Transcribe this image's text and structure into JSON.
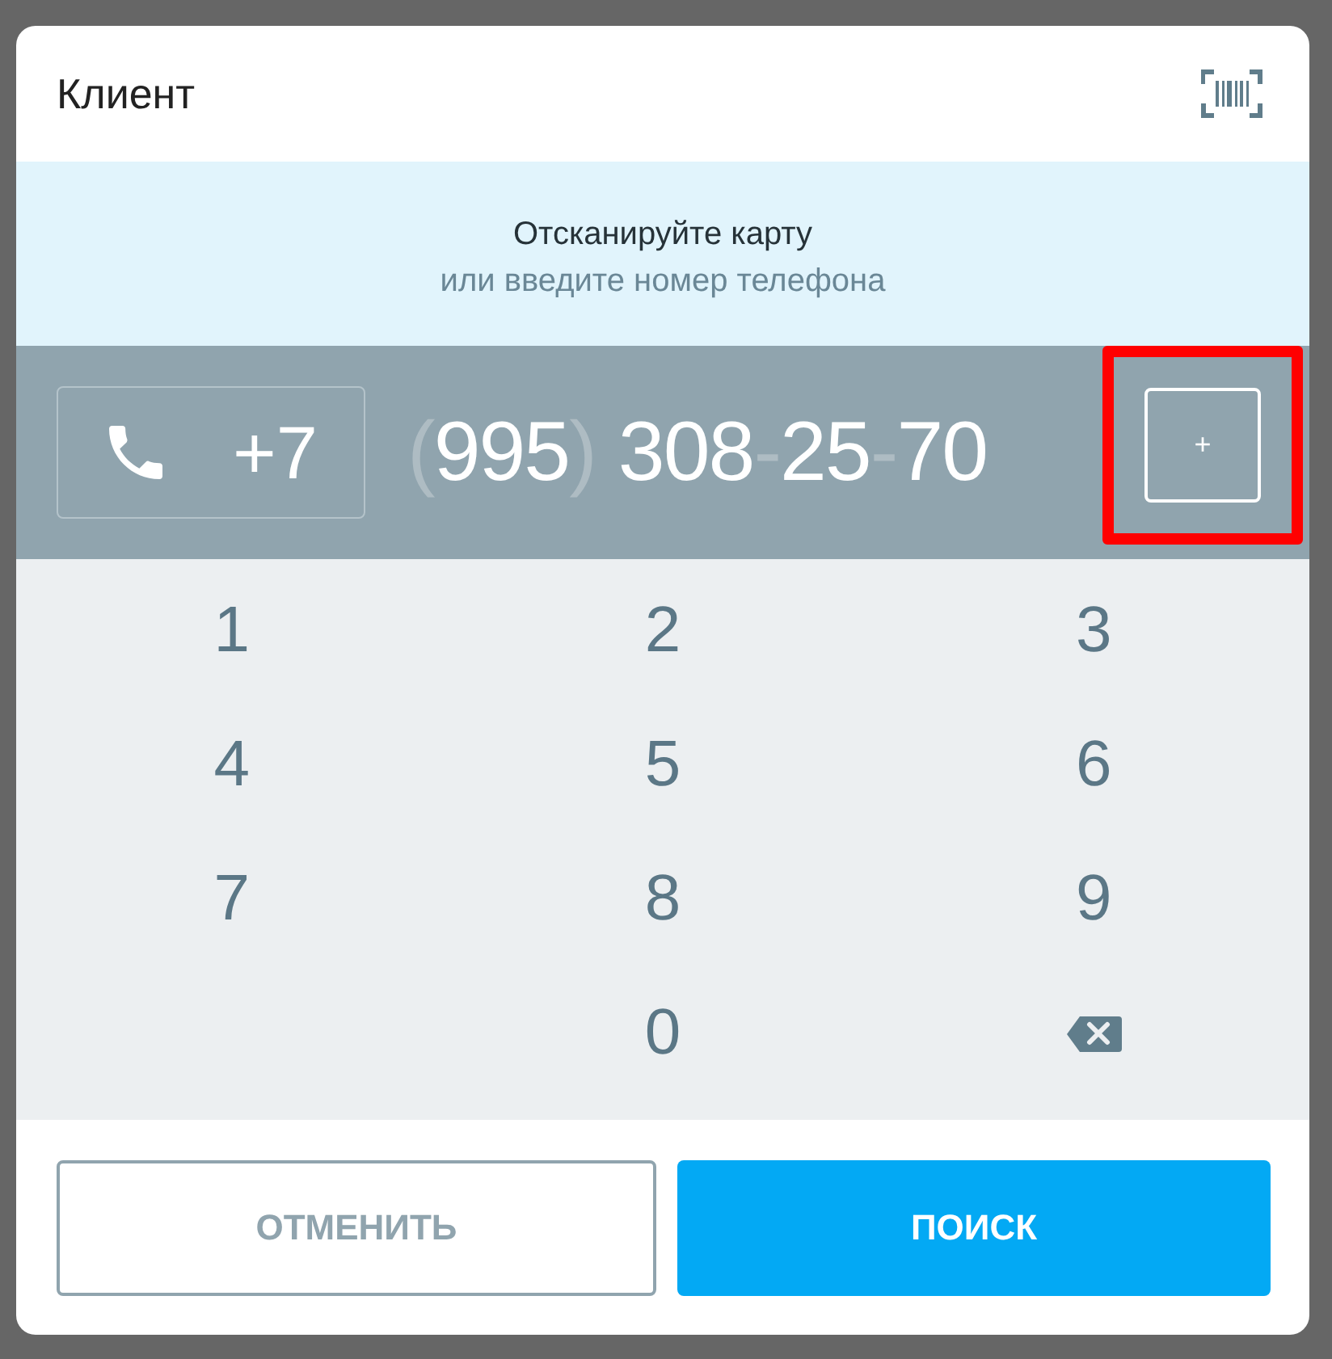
{
  "dialog": {
    "title": "Клиент"
  },
  "prompt": {
    "headline": "Отсканируйте карту",
    "subline": "или введите номер телефона"
  },
  "phone": {
    "country_code": "+7",
    "parts": [
      {
        "kind": "separator",
        "text": "("
      },
      {
        "kind": "digits",
        "text": "995"
      },
      {
        "kind": "closing",
        "text": ")"
      },
      {
        "kind": "digits",
        "text": "308"
      },
      {
        "kind": "separator",
        "text": "-"
      },
      {
        "kind": "digits",
        "text": "25"
      },
      {
        "kind": "separator",
        "text": "-"
      },
      {
        "kind": "digits",
        "text": "70"
      }
    ],
    "add_button": {
      "label": "+",
      "highlighted": true
    }
  },
  "keypad": [
    {
      "kind": "digit",
      "label": "1"
    },
    {
      "kind": "digit",
      "label": "2"
    },
    {
      "kind": "digit",
      "label": "3"
    },
    {
      "kind": "digit",
      "label": "4"
    },
    {
      "kind": "digit",
      "label": "5"
    },
    {
      "kind": "digit",
      "label": "6"
    },
    {
      "kind": "digit",
      "label": "7"
    },
    {
      "kind": "digit",
      "label": "8"
    },
    {
      "kind": "digit",
      "label": "9"
    },
    {
      "kind": "empty"
    },
    {
      "kind": "digit",
      "label": "0"
    },
    {
      "kind": "backspace"
    }
  ],
  "buttons": [
    {
      "kind": "secondary",
      "label": "ОТМЕНИТЬ"
    },
    {
      "kind": "primary",
      "label": "ПОИСК"
    }
  ]
}
